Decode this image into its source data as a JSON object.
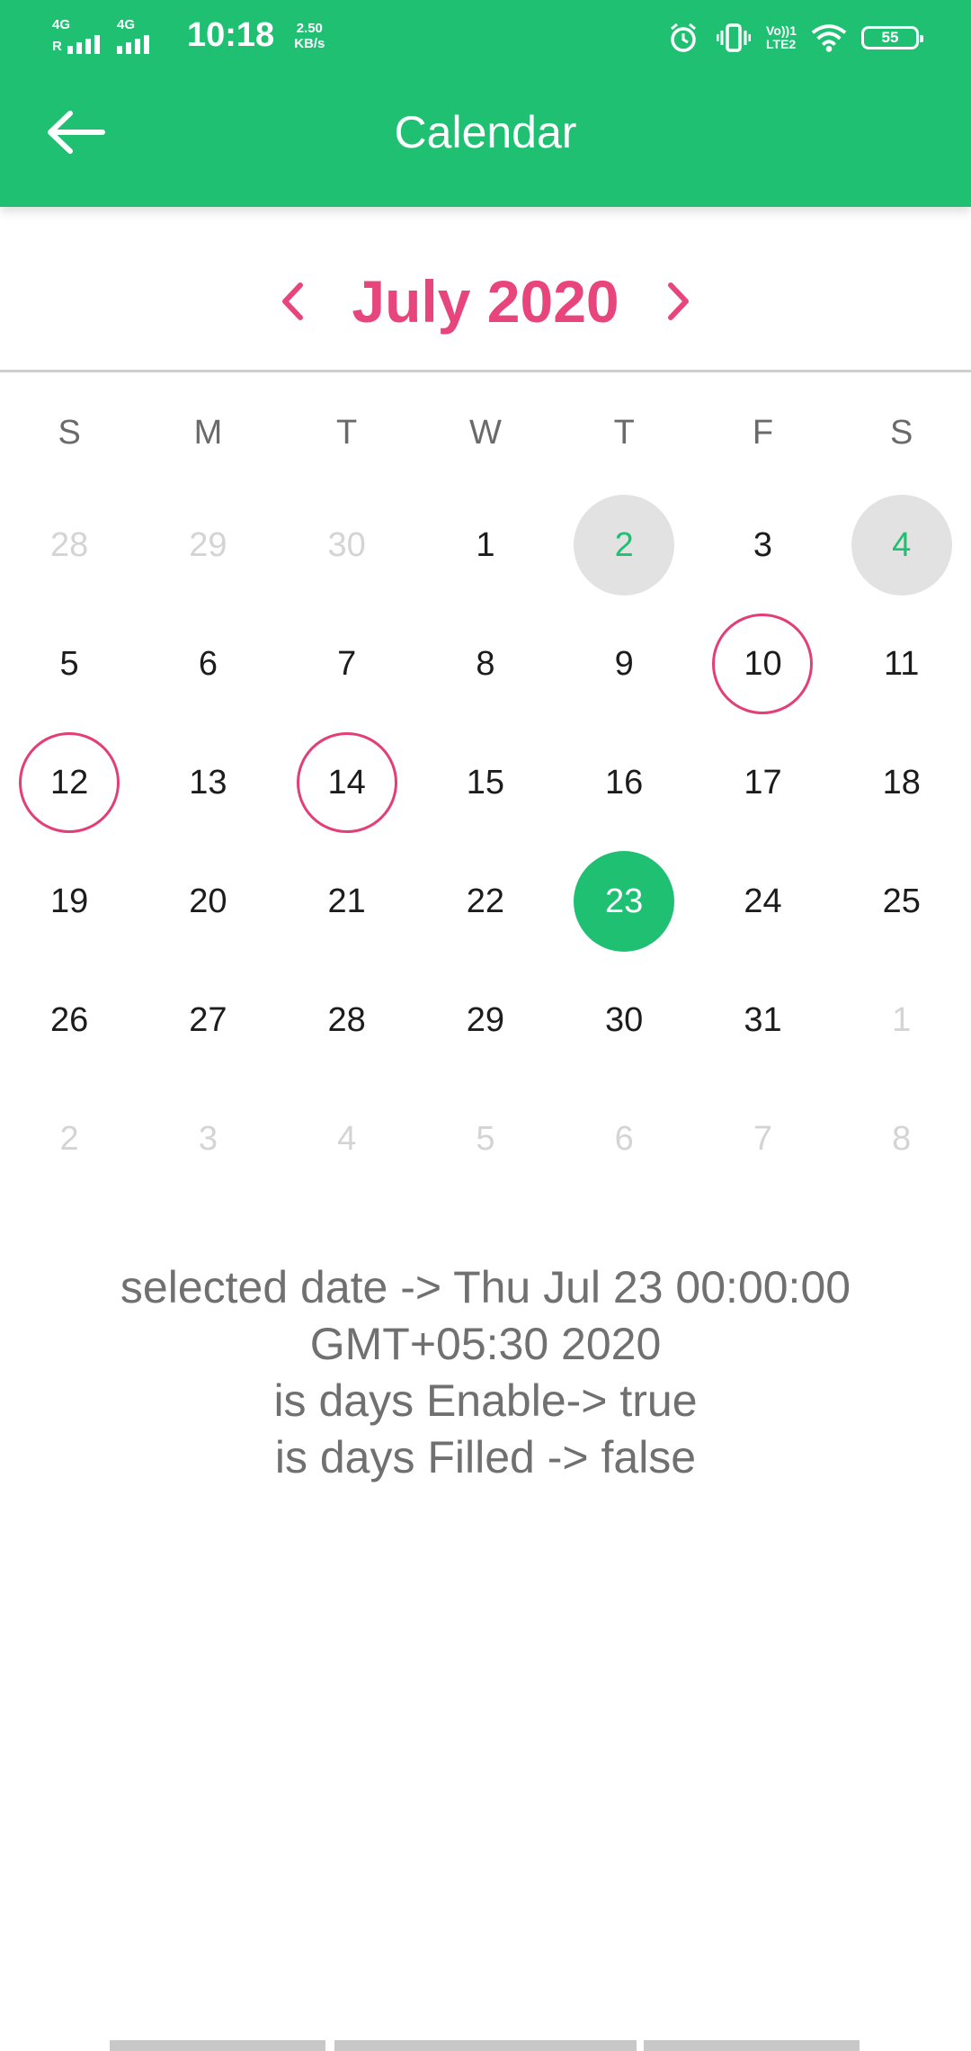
{
  "status_bar": {
    "sim1_tag": "4G",
    "sim1_sub": "R",
    "sim2_tag": "4G",
    "time": "10:18",
    "speed_value": "2.50",
    "speed_unit": "KB/s",
    "volte_line1": "Vo))1",
    "volte_line2": "LTE2",
    "battery": "55"
  },
  "app_bar": {
    "title": "Calendar",
    "back_icon": "arrow-left-icon"
  },
  "calendar": {
    "month_label": "July  2020",
    "prev_icon": "chevron-left-icon",
    "next_icon": "chevron-right-icon",
    "accent_color": "#e8457d",
    "weekdays": [
      "S",
      "M",
      "T",
      "W",
      "T",
      "F",
      "S"
    ],
    "weeks": [
      [
        {
          "d": "28",
          "state": "other"
        },
        {
          "d": "29",
          "state": "other"
        },
        {
          "d": "30",
          "state": "other"
        },
        {
          "d": "1",
          "state": "normal"
        },
        {
          "d": "2",
          "state": "disabled"
        },
        {
          "d": "3",
          "state": "normal"
        },
        {
          "d": "4",
          "state": "disabled"
        }
      ],
      [
        {
          "d": "5",
          "state": "normal"
        },
        {
          "d": "6",
          "state": "normal"
        },
        {
          "d": "7",
          "state": "normal"
        },
        {
          "d": "8",
          "state": "normal"
        },
        {
          "d": "9",
          "state": "normal"
        },
        {
          "d": "10",
          "state": "event"
        },
        {
          "d": "11",
          "state": "normal"
        }
      ],
      [
        {
          "d": "12",
          "state": "event"
        },
        {
          "d": "13",
          "state": "normal"
        },
        {
          "d": "14",
          "state": "event"
        },
        {
          "d": "15",
          "state": "normal"
        },
        {
          "d": "16",
          "state": "normal"
        },
        {
          "d": "17",
          "state": "normal"
        },
        {
          "d": "18",
          "state": "normal"
        }
      ],
      [
        {
          "d": "19",
          "state": "normal"
        },
        {
          "d": "20",
          "state": "normal"
        },
        {
          "d": "21",
          "state": "normal"
        },
        {
          "d": "22",
          "state": "normal"
        },
        {
          "d": "23",
          "state": "selected"
        },
        {
          "d": "24",
          "state": "normal"
        },
        {
          "d": "25",
          "state": "normal"
        }
      ],
      [
        {
          "d": "26",
          "state": "normal"
        },
        {
          "d": "27",
          "state": "normal"
        },
        {
          "d": "28",
          "state": "normal"
        },
        {
          "d": "29",
          "state": "normal"
        },
        {
          "d": "30",
          "state": "normal"
        },
        {
          "d": "31",
          "state": "normal"
        },
        {
          "d": "1",
          "state": "other"
        }
      ],
      [
        {
          "d": "2",
          "state": "other"
        },
        {
          "d": "3",
          "state": "other"
        },
        {
          "d": "4",
          "state": "other"
        },
        {
          "d": "5",
          "state": "other"
        },
        {
          "d": "6",
          "state": "other"
        },
        {
          "d": "7",
          "state": "other"
        },
        {
          "d": "8",
          "state": "other"
        }
      ]
    ],
    "colors": {
      "selected": "#20c073",
      "disabled_bg": "#e2e2e2",
      "event_ring": "#e23f74"
    }
  },
  "info": {
    "line1": "selected date -> Thu Jul 23 00:00:00",
    "line2": "GMT+05:30 2020",
    "line3": "is days Enable-> true",
    "line4": "is days Filled  -> false"
  },
  "theme": {
    "primary": "#20c073"
  }
}
